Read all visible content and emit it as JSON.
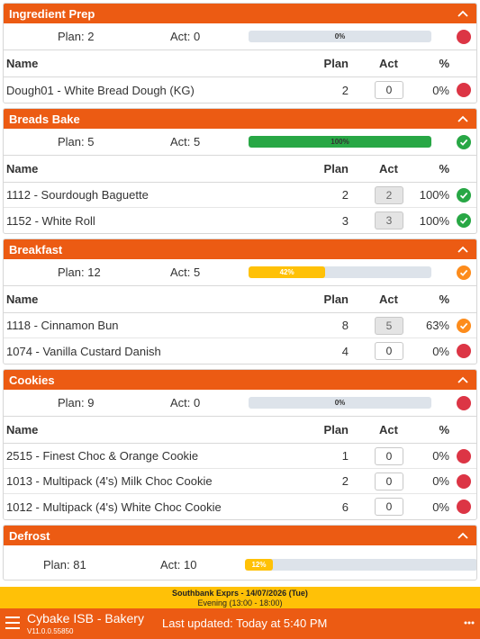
{
  "sections": [
    {
      "title": "Ingredient Prep",
      "plan_label": "Plan: 2",
      "act_label": "Act: 0",
      "progress": 0,
      "progress_label": "0%",
      "status": "red",
      "columns": {
        "name": "Name",
        "plan": "Plan",
        "act": "Act",
        "pct": "%"
      },
      "rows": [
        {
          "name": "Dough01 - White Bread Dough (KG)",
          "plan": "2",
          "act": "0",
          "pct": "0%",
          "status": "red",
          "done": false
        }
      ]
    },
    {
      "title": "Breads Bake",
      "plan_label": "Plan: 5",
      "act_label": "Act: 5",
      "progress": 100,
      "progress_label": "100%",
      "status": "green",
      "columns": {
        "name": "Name",
        "plan": "Plan",
        "act": "Act",
        "pct": "%"
      },
      "rows": [
        {
          "name": "1112 - Sourdough Baguette",
          "plan": "2",
          "act": "2",
          "pct": "100%",
          "status": "green",
          "done": true
        },
        {
          "name": "1152 - White Roll",
          "plan": "3",
          "act": "3",
          "pct": "100%",
          "status": "green",
          "done": true
        }
      ]
    },
    {
      "title": "Breakfast",
      "plan_label": "Plan: 12",
      "act_label": "Act: 5",
      "progress": 42,
      "progress_label": "42%",
      "status": "orange",
      "columns": {
        "name": "Name",
        "plan": "Plan",
        "act": "Act",
        "pct": "%"
      },
      "rows": [
        {
          "name": "1118 - Cinnamon Bun",
          "plan": "8",
          "act": "5",
          "pct": "63%",
          "status": "orange",
          "done": true
        },
        {
          "name": "1074 - Vanilla Custard Danish",
          "plan": "4",
          "act": "0",
          "pct": "0%",
          "status": "red",
          "done": false
        }
      ]
    },
    {
      "title": "Cookies",
      "plan_label": "Plan: 9",
      "act_label": "Act: 0",
      "progress": 0,
      "progress_label": "0%",
      "status": "red",
      "columns": {
        "name": "Name",
        "plan": "Plan",
        "act": "Act",
        "pct": "%"
      },
      "rows": [
        {
          "name": "2515 - Finest Choc & Orange Cookie",
          "plan": "1",
          "act": "0",
          "pct": "0%",
          "status": "red",
          "done": false
        },
        {
          "name": "1013 - Multipack (4's) Milk Choc Cookie",
          "plan": "2",
          "act": "0",
          "pct": "0%",
          "status": "red",
          "done": false
        },
        {
          "name": "1012 - Multipack (4's) White Choc Cookie",
          "plan": "6",
          "act": "0",
          "pct": "0%",
          "status": "red",
          "done": false
        }
      ]
    }
  ],
  "defrost": {
    "title": "Defrost",
    "plan_label": "Plan: 81",
    "act_label": "Act: 10",
    "progress": 12,
    "progress_label": "12%"
  },
  "infobar": {
    "line1": "Southbank Exprs - 14/07/2026 (Tue)",
    "line2": "Evening (13:00 - 18:00)"
  },
  "footer": {
    "app_name": "Cybake ISB - Bakery",
    "version": "V11.0.0.55850",
    "updated": "Last updated:  Today at 5:40 PM"
  },
  "colors": {
    "header": "#ec5b13",
    "info": "#ffc107",
    "red": "#dc3545",
    "green": "#28a745",
    "orange": "#fd8c1c",
    "bar_green": "#28a745",
    "bar_yellow": "#ffc107"
  },
  "icons": {
    "collapse": "chevron-up-icon",
    "menu": "hamburger-menu-icon",
    "more": "more-dots-icon",
    "check": "check-icon"
  }
}
